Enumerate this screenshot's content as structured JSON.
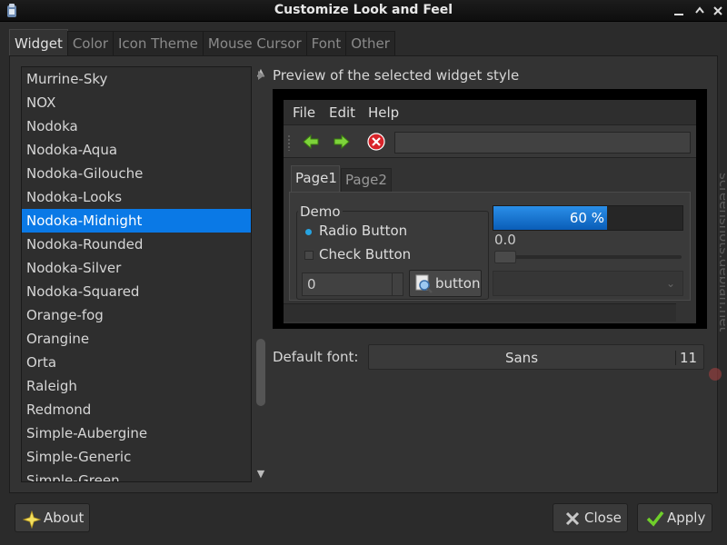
{
  "window": {
    "title": "Customize Look and Feel"
  },
  "tabs": [
    "Widget",
    "Color",
    "Icon Theme",
    "Mouse Cursor",
    "Font",
    "Other"
  ],
  "theme_list": {
    "items": [
      "Murrine-Sky",
      "NOX",
      "Nodoka",
      "Nodoka-Aqua",
      "Nodoka-Gilouche",
      "Nodoka-Looks",
      "Nodoka-Midnight",
      "Nodoka-Rounded",
      "Nodoka-Silver",
      "Nodoka-Squared",
      "Orange-fog",
      "Orangine",
      "Orta",
      "Raleigh",
      "Redmond",
      "Simple-Aubergine",
      "Simple-Generic",
      "Simple-Green"
    ],
    "selected": "Nodoka-Midnight"
  },
  "preview": {
    "label": "Preview of the selected widget style",
    "menu": [
      "File",
      "Edit",
      "Help"
    ],
    "toolbar_icons": [
      "back-arrow-icon",
      "forward-arrow-icon",
      "stop-icon"
    ],
    "notebook_tabs": [
      "Page1",
      "Page2"
    ],
    "frame_label": "Demo",
    "radio_label": "Radio Button",
    "check_label": "Check Button",
    "spin_value": "0",
    "button_label": "button",
    "progress_text": "60 %",
    "progress_value": 0.6,
    "scale_value": "0.0"
  },
  "font": {
    "label": "Default font:",
    "name": "Sans",
    "size": "11"
  },
  "buttons": {
    "about": "About",
    "close": "Close",
    "apply": "Apply"
  },
  "watermark": "screenshots.debian.net",
  "colors": {
    "selection": "#0a79e6",
    "progress": "#1f7fd9",
    "radio": "#27a3e0"
  }
}
